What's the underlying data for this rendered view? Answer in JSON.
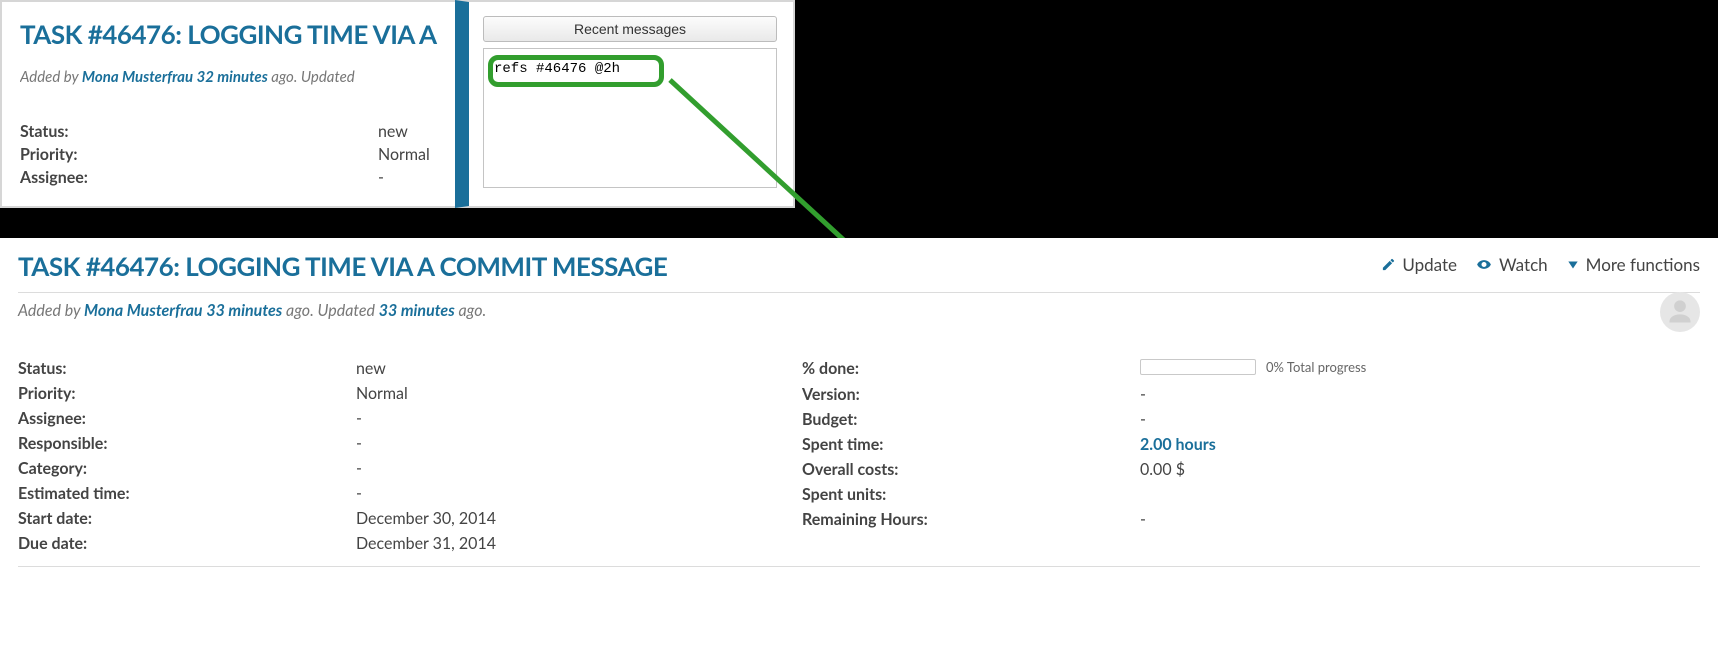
{
  "overlay_task": {
    "title": "TASK #46476: LOGGING TIME VIA A",
    "meta_prefix": "Added by ",
    "author": "Mona Musterfrau",
    "time": "32 minutes",
    "meta_mid": " ago. Updated ",
    "status_label": "Status:",
    "status_value": "new",
    "priority_label": "Priority:",
    "priority_value": "Normal",
    "assignee_label": "Assignee:",
    "assignee_value": "-"
  },
  "commit_box": {
    "recent_btn": "Recent messages",
    "text": "refs #46476 @2h"
  },
  "task": {
    "title": "TASK #46476: LOGGING TIME VIA A COMMIT MESSAGE",
    "meta_prefix": "Added by ",
    "author": "Mona Musterfrau",
    "time_added": "33 minutes",
    "meta_mid": " ago. Updated ",
    "time_updated": "33 minutes",
    "meta_suffix": " ago.",
    "actions": {
      "update": "Update",
      "watch": "Watch",
      "more": "More functions"
    },
    "left": [
      {
        "label": "Status:",
        "value": "new"
      },
      {
        "label": "Priority:",
        "value": "Normal"
      },
      {
        "label": "Assignee:",
        "value": "-"
      },
      {
        "label": "Responsible:",
        "value": "-"
      },
      {
        "label": "Category:",
        "value": "-"
      },
      {
        "label": "Estimated time:",
        "value": "-"
      },
      {
        "label": "Start date:",
        "value": "December 30, 2014"
      },
      {
        "label": "Due date:",
        "value": "December 31, 2014"
      }
    ],
    "right": [
      {
        "label": "% done:",
        "value": "",
        "progress": {
          "pct": 0,
          "text": "0% Total progress"
        }
      },
      {
        "label": "Version:",
        "value": "-"
      },
      {
        "label": "Budget:",
        "value": "-"
      },
      {
        "label": "Spent time:",
        "value": "2.00 hours",
        "link": true
      },
      {
        "label": "Overall costs:",
        "value": "0.00 $"
      },
      {
        "label": "Spent units:",
        "value": ""
      },
      {
        "label": "Remaining Hours:",
        "value": "-"
      }
    ]
  }
}
